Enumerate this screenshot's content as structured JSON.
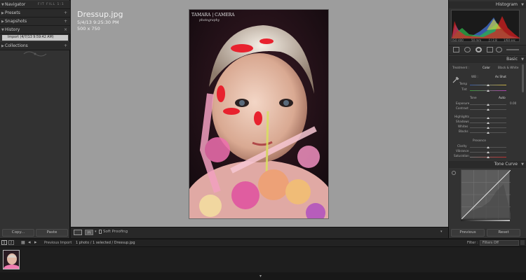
{
  "left_panel": {
    "navigator": {
      "title": "Navigator",
      "views": "FIT FILL 1:1 3:1"
    },
    "presets": {
      "title": "Presets"
    },
    "snapshots": {
      "title": "Snapshots"
    },
    "history": {
      "title": "History",
      "items": [
        "Import (4/7/13 9:59:42 AM)"
      ]
    },
    "collections": {
      "title": "Collections"
    },
    "copy_label": "Copy...",
    "paste_label": "Paste"
  },
  "photo_info": {
    "filename": "Dressup.jpg",
    "datetime": "5/4/13 9:25:30 PM",
    "dimensions": "500 x 750"
  },
  "photo": {
    "watermark_line1": "TAMARA | CAMERA",
    "watermark_line2": "photography"
  },
  "toolbar": {
    "soft_proofing": "Soft Proofing"
  },
  "right_panel": {
    "histogram": {
      "title": "Histogram",
      "iso": "ISO 400",
      "focal": "50 mm",
      "aperture": "ƒ / 2.8",
      "shutter": "1/60 sec"
    },
    "basic": {
      "title": "Basic",
      "treatment_label": "Treatment :",
      "color_label": "Color",
      "bw_label": "Black & White",
      "wb_label": "WB :",
      "wb_value": "As Shot",
      "temp_label": "Temp",
      "tint_label": "Tint",
      "tone_label": "Tone",
      "auto_label": "Auto",
      "exposure_label": "Exposure",
      "exposure_value": "0.00",
      "contrast_label": "Contrast",
      "highlights_label": "Highlights",
      "shadows_label": "Shadows",
      "whites_label": "Whites",
      "blacks_label": "Blacks",
      "presence_label": "Presence",
      "clarity_label": "Clarity",
      "vibrance_label": "Vibrance",
      "saturation_label": "Saturation"
    },
    "tone_curve": {
      "title": "Tone Curve"
    },
    "previous_label": "Previous",
    "reset_label": "Reset"
  },
  "filmstrip": {
    "page1": "1",
    "page2": "2",
    "source": "Previous Import",
    "selection": "1 photo / 1 selected / Dressup.jpg",
    "filter_label": "Filter :",
    "filter_value": "Filters Off"
  },
  "colors": {
    "center_bg": "#9d9d9d",
    "panel_bg": "#323232",
    "header_bg": "#2a2a2a"
  }
}
